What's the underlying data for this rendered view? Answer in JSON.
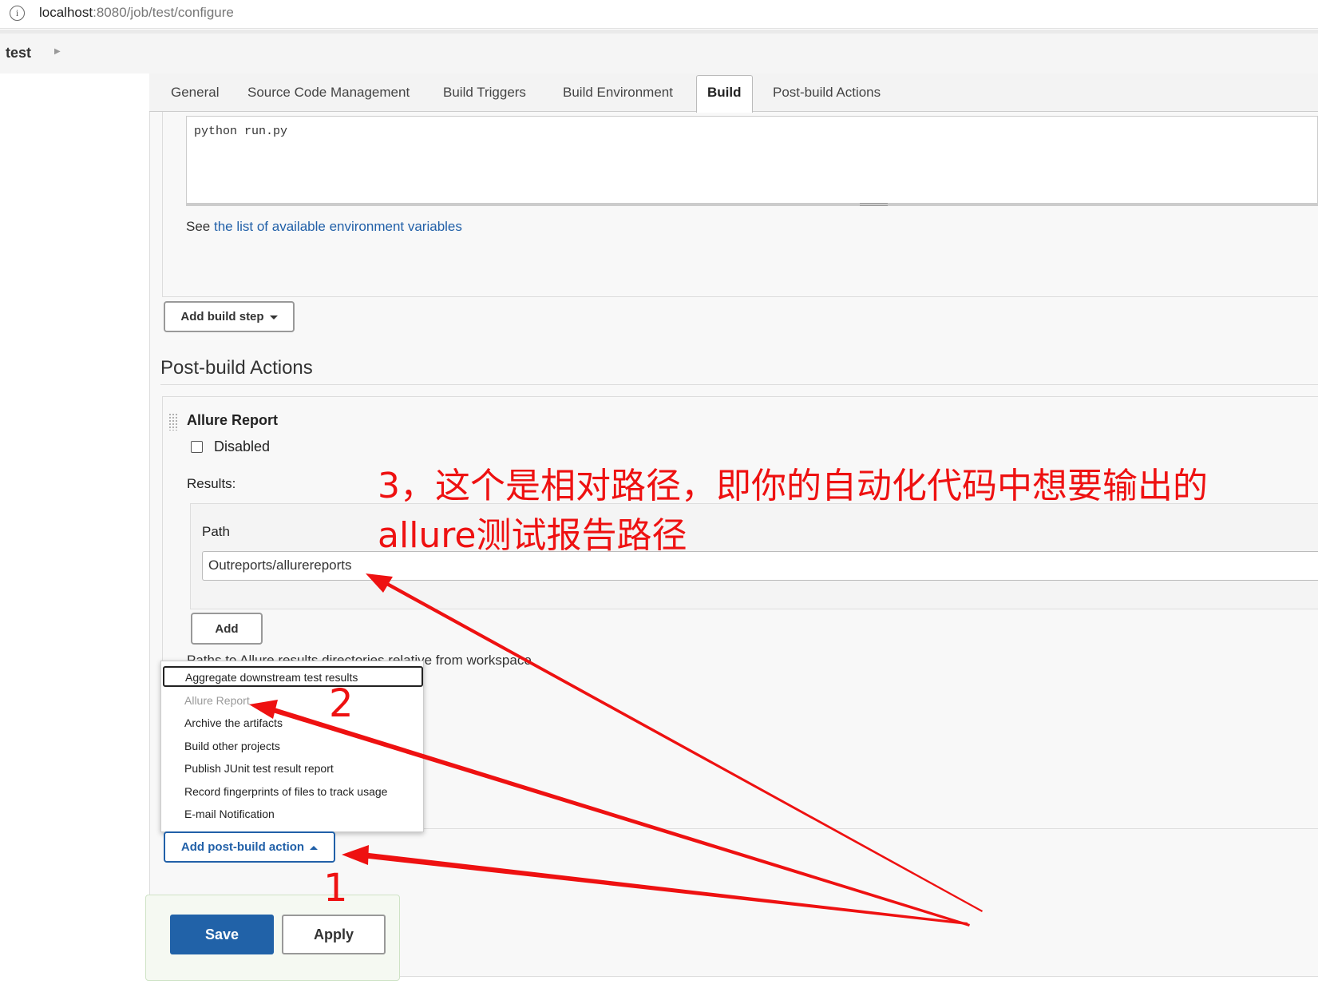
{
  "browser": {
    "url_host": "localhost",
    "url_rest": ":8080/job/test/configure",
    "info_icon": "info-icon"
  },
  "breadcrumb": {
    "job": "test"
  },
  "tabs": [
    "General",
    "Source Code Management",
    "Build Triggers",
    "Build Environment",
    "Build",
    "Post-build Actions"
  ],
  "active_tab": "Build",
  "build": {
    "command": "python run.py",
    "env_see": "See",
    "env_link": "the list of available environment variables",
    "add_step": "Add build step"
  },
  "post_build": {
    "title": "Post-build Actions",
    "allure": {
      "title": "Allure Report",
      "disabled_label": "Disabled",
      "results_label": "Results:",
      "path_label": "Path",
      "path_value": "Outreports/allurereports",
      "add_label": "Add",
      "paths_note": "Paths to Allure results directories relative from workspace."
    },
    "add_action": "Add post-build action",
    "menu": [
      "Aggregate downstream test results",
      "Allure Report",
      "Archive the artifacts",
      "Build other projects",
      "Publish JUnit test result report",
      "Record fingerprints of files to track usage",
      "E-mail Notification"
    ]
  },
  "footer": {
    "save": "Save",
    "apply": "Apply"
  },
  "annotations": {
    "step1": "1",
    "step2": "2",
    "step3_line1": "3，这个是相对路径，即你的自动化代码中想要输出的",
    "step3_line2": "allure测试报告路径",
    "color": "#ee1111"
  }
}
